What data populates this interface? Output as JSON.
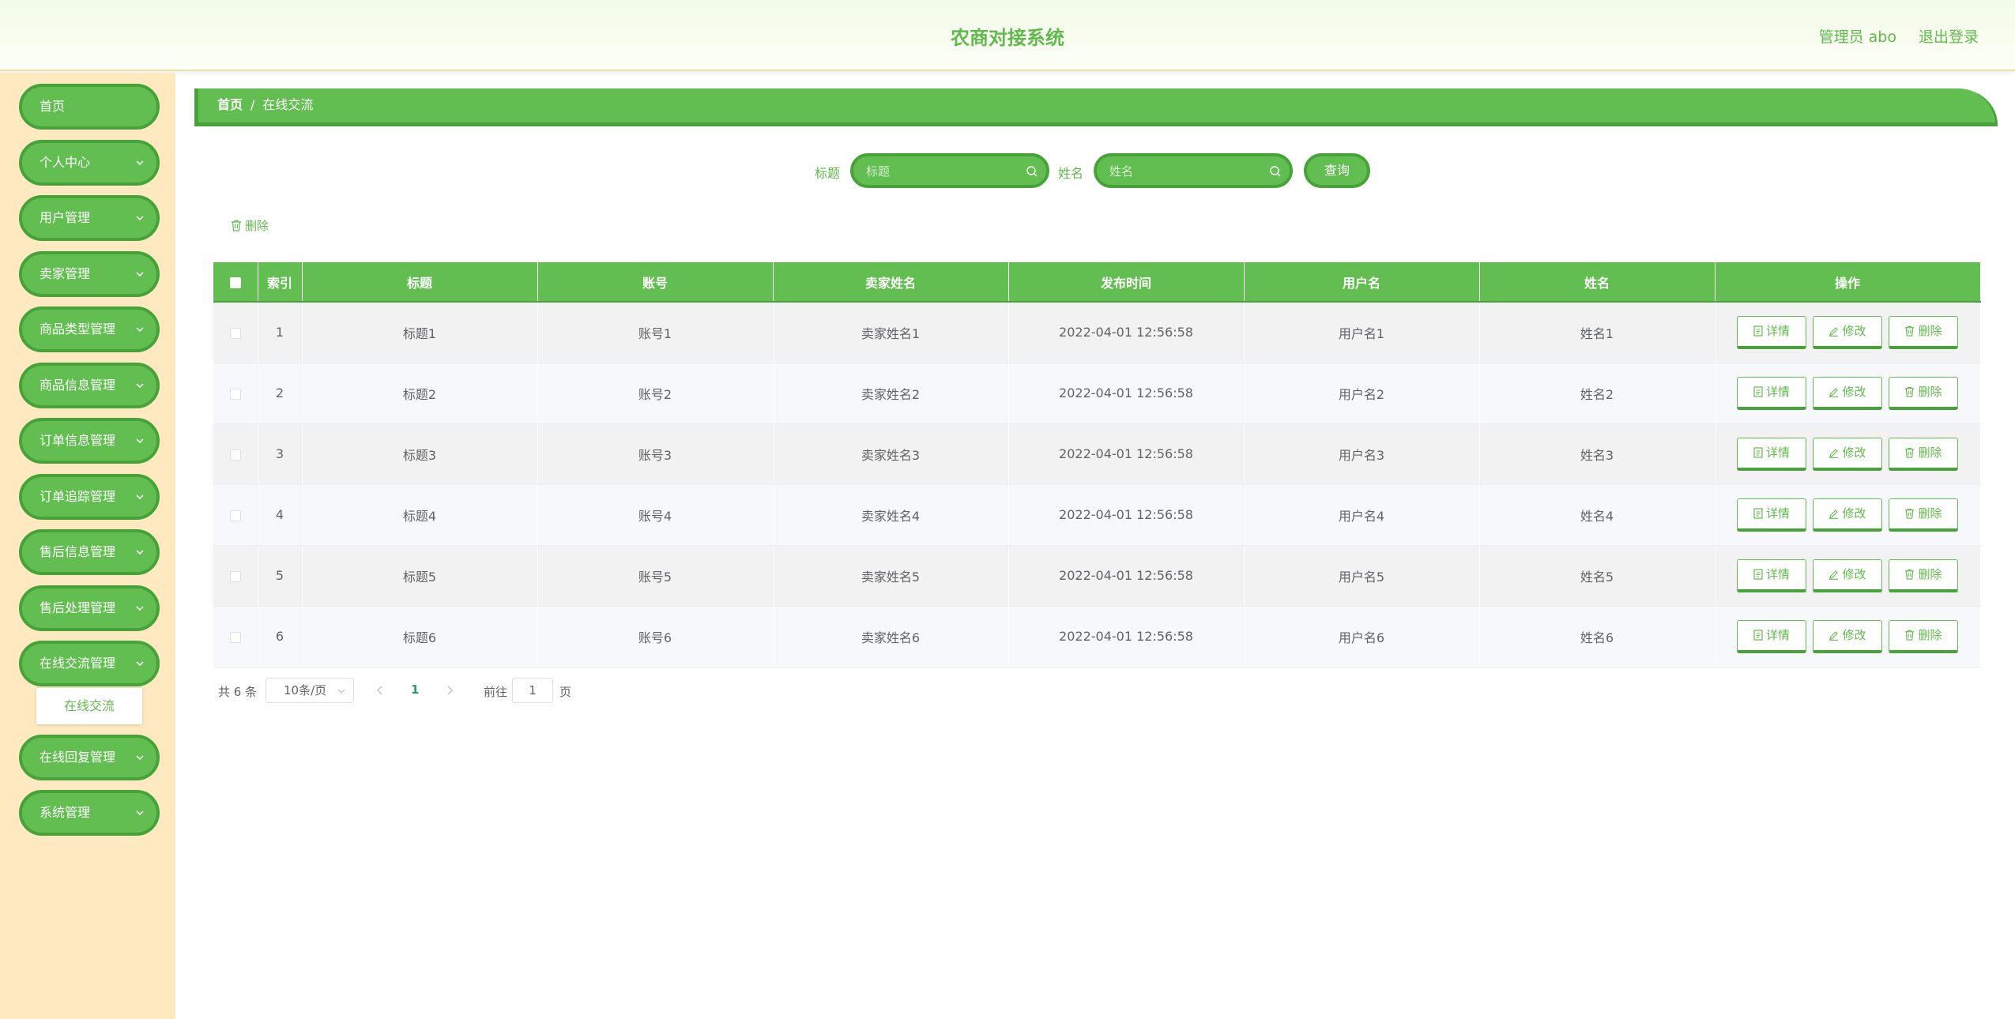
{
  "header": {
    "title": "农商对接系统",
    "user": "管理员 abo",
    "logout": "退出登录"
  },
  "sidebar": {
    "items": [
      {
        "label": "首页",
        "has_arrow": false
      },
      {
        "label": "个人中心",
        "has_arrow": true
      },
      {
        "label": "用户管理",
        "has_arrow": true
      },
      {
        "label": "卖家管理",
        "has_arrow": true
      },
      {
        "label": "商品类型管理",
        "has_arrow": true
      },
      {
        "label": "商品信息管理",
        "has_arrow": true
      },
      {
        "label": "订单信息管理",
        "has_arrow": true
      },
      {
        "label": "订单追踪管理",
        "has_arrow": true
      },
      {
        "label": "售后信息管理",
        "has_arrow": true
      },
      {
        "label": "售后处理管理",
        "has_arrow": true
      },
      {
        "label": "在线交流管理",
        "has_arrow": true,
        "expanded": true
      },
      {
        "label": "在线回复管理",
        "has_arrow": true
      },
      {
        "label": "系统管理",
        "has_arrow": true
      }
    ],
    "submenu": {
      "label": "在线交流"
    }
  },
  "breadcrumb": {
    "home": "首页",
    "separator": "/",
    "current": "在线交流"
  },
  "search": {
    "title_label": "标题",
    "title_placeholder": "标题",
    "name_label": "姓名",
    "name_placeholder": "姓名",
    "query_button": "查询"
  },
  "actions": {
    "bulk_delete": "删除"
  },
  "table": {
    "columns": [
      "索引",
      "标题",
      "账号",
      "卖家姓名",
      "发布时间",
      "用户名",
      "姓名",
      "操作"
    ],
    "rows": [
      {
        "index": "1",
        "title": "标题1",
        "account": "账号1",
        "seller": "卖家姓名1",
        "time": "2022-04-01 12:56:58",
        "username": "用户名1",
        "name": "姓名1"
      },
      {
        "index": "2",
        "title": "标题2",
        "account": "账号2",
        "seller": "卖家姓名2",
        "time": "2022-04-01 12:56:58",
        "username": "用户名2",
        "name": "姓名2"
      },
      {
        "index": "3",
        "title": "标题3",
        "account": "账号3",
        "seller": "卖家姓名3",
        "time": "2022-04-01 12:56:58",
        "username": "用户名3",
        "name": "姓名3"
      },
      {
        "index": "4",
        "title": "标题4",
        "account": "账号4",
        "seller": "卖家姓名4",
        "time": "2022-04-01 12:56:58",
        "username": "用户名4",
        "name": "姓名4"
      },
      {
        "index": "5",
        "title": "标题5",
        "account": "账号5",
        "seller": "卖家姓名5",
        "time": "2022-04-01 12:56:58",
        "username": "用户名5",
        "name": "姓名5"
      },
      {
        "index": "6",
        "title": "标题6",
        "account": "账号6",
        "seller": "卖家姓名6",
        "time": "2022-04-01 12:56:58",
        "username": "用户名6",
        "name": "姓名6"
      }
    ],
    "row_actions": {
      "detail": "详情",
      "edit": "修改",
      "delete": "删除"
    }
  },
  "pagination": {
    "total_text": "共 6 条",
    "page_size": "10条/页",
    "current_page": "1",
    "goto_label": "前往",
    "goto_value": "1",
    "goto_suffix": "页"
  },
  "colors": {
    "primary": "#62be50",
    "primary_dark": "#48a23a",
    "sidebar_bg": "#ffe9c0",
    "text": "#606266"
  }
}
